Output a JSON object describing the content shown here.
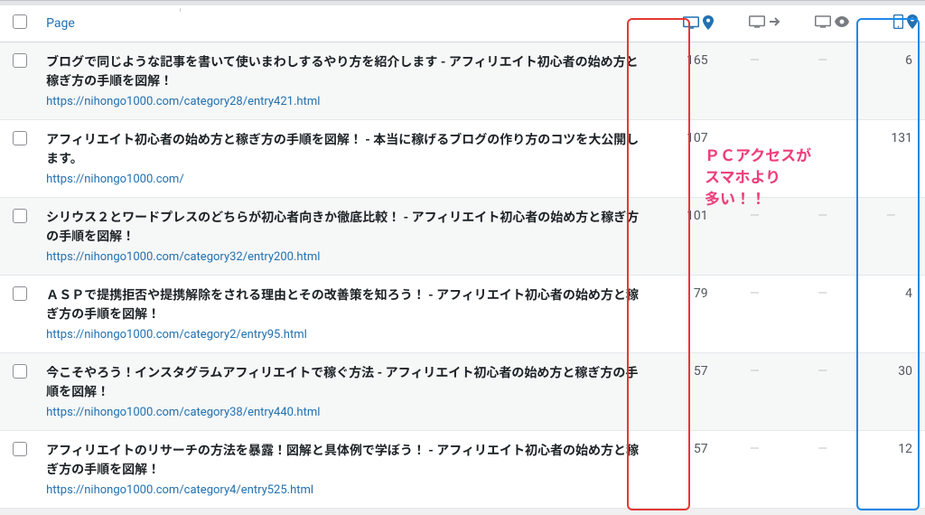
{
  "header": {
    "page_label": "Page"
  },
  "annotation": "ＰＣアクセスが\nスマホより\n多い！！",
  "icons": {
    "desktop_pin": "desktop-pin",
    "desktop_arrow": "desktop-arrow",
    "desktop_eye": "desktop-eye",
    "mobile_pin": "mobile-pin"
  },
  "rows": [
    {
      "title": "ブログで同じような記事を書いて使いまわしするやり方を紹介します - アフィリエイト初心者の始め方と稼ぎ方の手順を図解！",
      "url": "https://nihongo1000.com/category28/entry421.html",
      "c1": "165",
      "c2": "—",
      "c3": "—",
      "c4": "6"
    },
    {
      "title": "アフィリエイト初心者の始め方と稼ぎ方の手順を図解！ - 本当に稼げるブログの作り方のコツを大公開します。",
      "url": "https://nihongo1000.com/",
      "c1": "107",
      "c2": "",
      "c3": "",
      "c4": "131"
    },
    {
      "title": "シリウス２とワードプレスのどちらが初心者向きか徹底比較！ - アフィリエイト初心者の始め方と稼ぎ方の手順を図解！",
      "url": "https://nihongo1000.com/category32/entry200.html",
      "c1": "101",
      "c2": "—",
      "c3": "—",
      "c4": "—"
    },
    {
      "title": "ＡＳＰで提携拒否や提携解除をされる理由とその改善策を知ろう！ - アフィリエイト初心者の始め方と稼ぎ方の手順を図解！",
      "url": "https://nihongo1000.com/category2/entry95.html",
      "c1": "79",
      "c2": "—",
      "c3": "—",
      "c4": "4"
    },
    {
      "title": "今こそやろう！インスタグラムアフィリエイトで稼ぐ方法 - アフィリエイト初心者の始め方と稼ぎ方の手順を図解！",
      "url": "https://nihongo1000.com/category38/entry440.html",
      "c1": "57",
      "c2": "—",
      "c3": "—",
      "c4": "30"
    },
    {
      "title": "アフィリエイトのリサーチの方法を暴露！図解と具体例で学ぼう！ - アフィリエイト初心者の始め方と稼ぎ方の手順を図解！",
      "url": "https://nihongo1000.com/category4/entry525.html",
      "c1": "57",
      "c2": "—",
      "c3": "—",
      "c4": "12"
    }
  ]
}
